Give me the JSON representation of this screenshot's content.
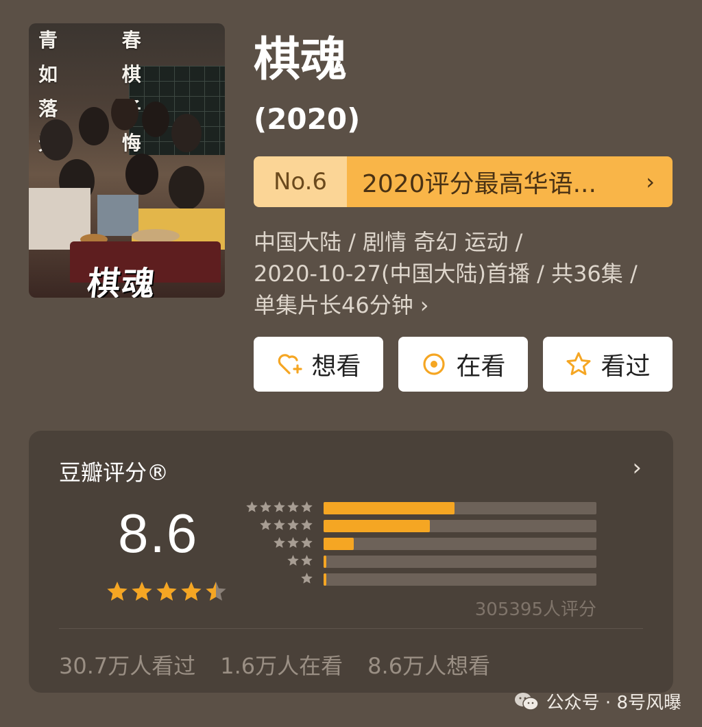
{
  "poster": {
    "slogan_line1": "青 春 如 棋",
    "slogan_line2": "落 子 无 悔",
    "title_art": "棋魂"
  },
  "title": "棋魂",
  "year": "(2020)",
  "rank": {
    "number": "No.6",
    "text": "2020评分最高华语...",
    "chevron": "›"
  },
  "meta": {
    "line1": "中国大陆 / 剧情 奇幻 运动 /",
    "line2": "2020-10-27(中国大陆)首播 / 共36集 /",
    "line3": "单集片长46分钟",
    "chevron": "›"
  },
  "buttons": {
    "want": "想看",
    "watching": "在看",
    "watched": "看过"
  },
  "rating": {
    "label": "豆瓣评分®",
    "chevron": "›",
    "score": "8.6",
    "star_value": 4.5,
    "distribution": [
      {
        "stars": 5,
        "fraction": 0.48
      },
      {
        "stars": 4,
        "fraction": 0.39
      },
      {
        "stars": 3,
        "fraction": 0.11
      },
      {
        "stars": 2,
        "fraction": 0.01
      },
      {
        "stars": 1,
        "fraction": 0.01
      }
    ],
    "total": "305395人评分",
    "stats": [
      "30.7万人看过",
      "1.6万人在看",
      "8.6万人想看"
    ]
  },
  "watermark": {
    "text": "公众号 · 8号风曝"
  },
  "colors": {
    "background": "#5b5046",
    "accent": "#f5a623",
    "rank_light": "#fbd596",
    "rank_dark": "#f9b548"
  }
}
